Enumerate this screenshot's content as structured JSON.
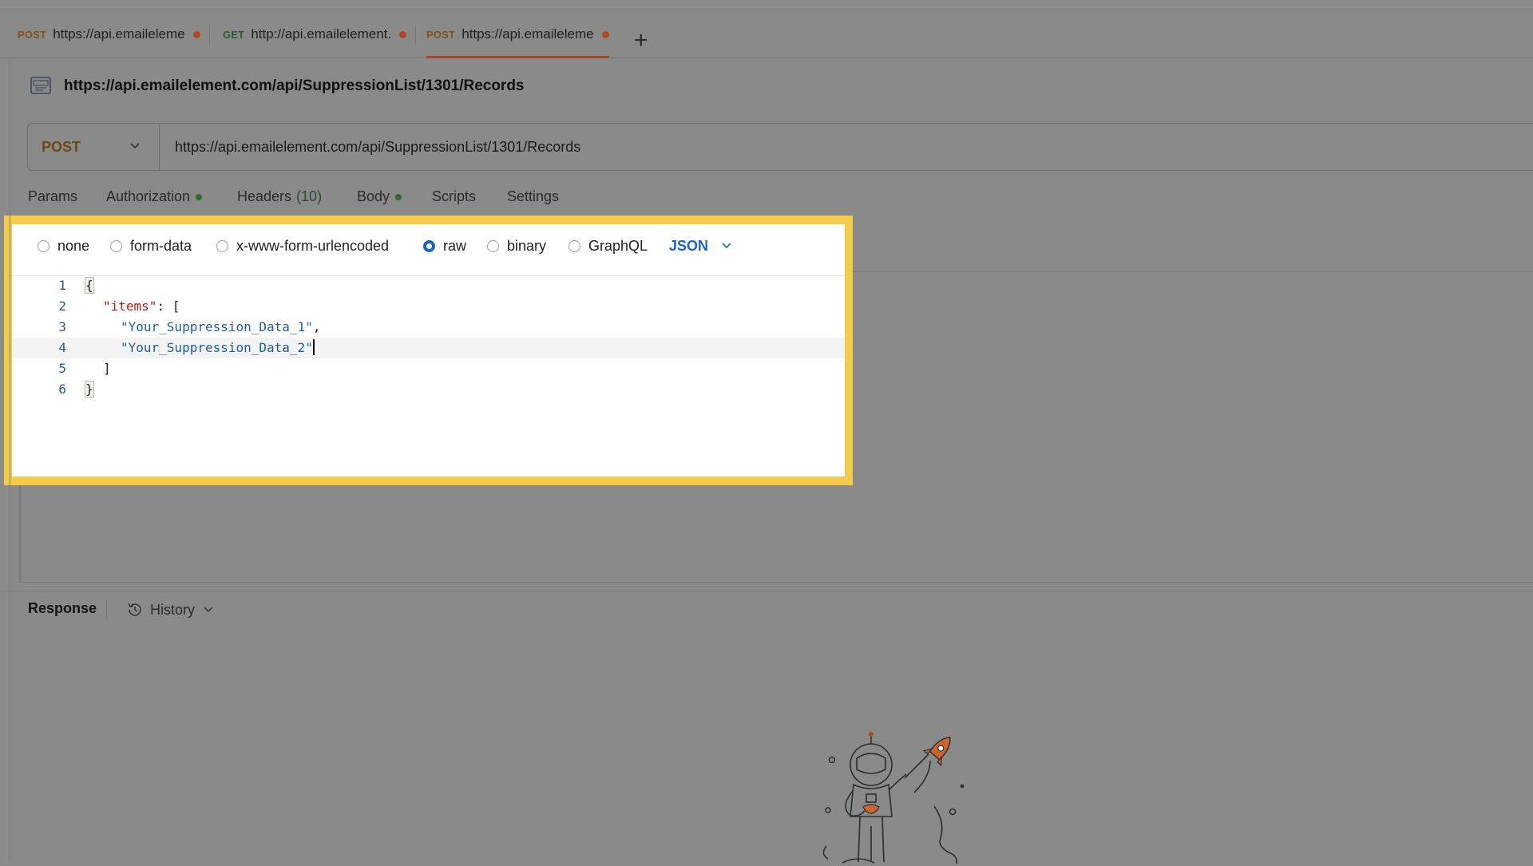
{
  "tabs": [
    {
      "method": "POST",
      "label": "https://api.emaileleme",
      "unsaved": true,
      "active": false
    },
    {
      "method": "GET",
      "label": "http://api.emailelement.",
      "unsaved": true,
      "active": false
    },
    {
      "method": "POST",
      "label": "https://api.emaileleme",
      "unsaved": true,
      "active": true
    }
  ],
  "request": {
    "title": "https://api.emailelement.com/api/SuppressionList/1301/Records",
    "method": "POST",
    "url": "https://api.emailelement.com/api/SuppressionList/1301/Records"
  },
  "request_tabs": {
    "params": "Params",
    "authorization": "Authorization",
    "headers": "Headers",
    "headers_count": "(10)",
    "body": "Body",
    "scripts": "Scripts",
    "settings": "Settings"
  },
  "body": {
    "options": [
      "none",
      "form-data",
      "x-www-form-urlencoded",
      "raw",
      "binary",
      "GraphQL"
    ],
    "selected": "raw",
    "format": "JSON"
  },
  "code": {
    "line_numbers": [
      "1",
      "2",
      "3",
      "4",
      "5",
      "6"
    ],
    "l1": "{",
    "l2_key": "\"items\"",
    "l2_rest": ": [",
    "l3_str": "\"Your_Suppression_Data_1\"",
    "l3_rest": ",",
    "l4_str": "\"Your_Suppression_Data_2\"",
    "l5": "]",
    "l6": "}"
  },
  "response": {
    "label": "Response",
    "history": "History"
  },
  "colors": {
    "highlight": "#f3cd4a",
    "accent_blue": "#1a63c7",
    "unsaved_dot": "#b14a22",
    "status_green": "#2f6b2b"
  }
}
